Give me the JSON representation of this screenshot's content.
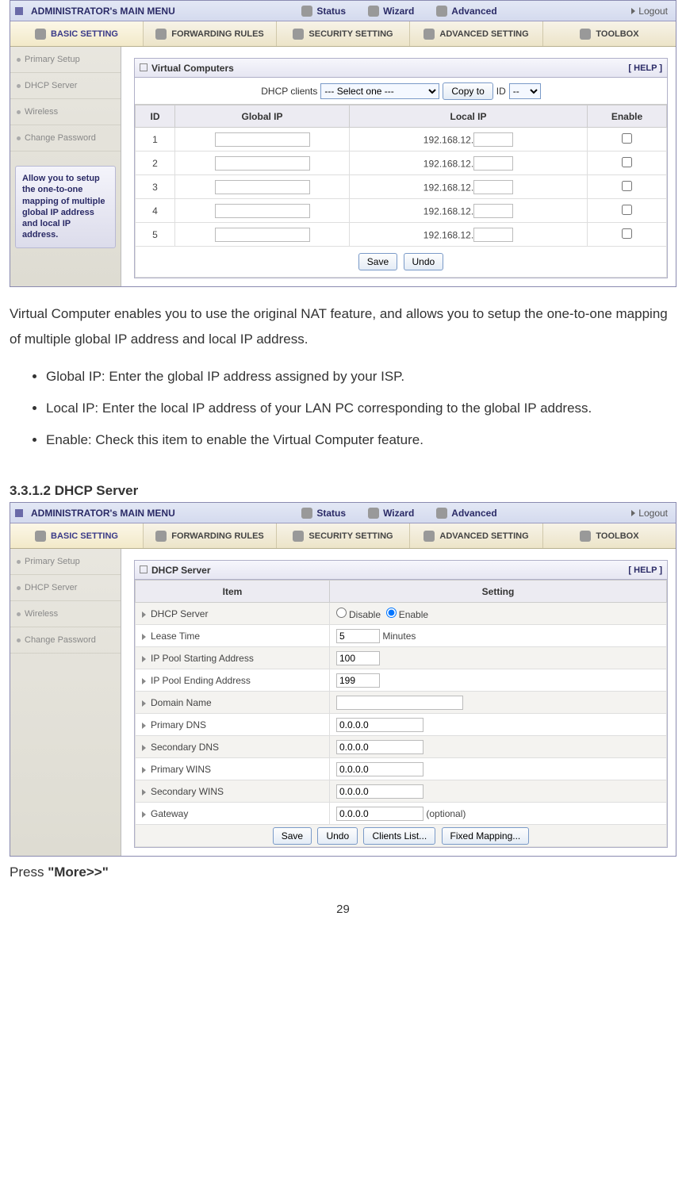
{
  "topbar": {
    "admin": "ADMINISTRATOR's MAIN MENU",
    "status": "Status",
    "wizard": "Wizard",
    "advanced": "Advanced",
    "logout": "Logout"
  },
  "tabs": {
    "basic": "BASIC SETTING",
    "forwarding": "FORWARDING RULES",
    "security": "SECURITY SETTING",
    "advanced": "ADVANCED SETTING",
    "toolbox": "TOOLBOX"
  },
  "sidebar": {
    "primary": "Primary Setup",
    "dhcp": "DHCP Server",
    "wireless": "Wireless",
    "password": "Change Password",
    "help": "Allow you to setup the one-to-one mapping of multiple global IP address and local IP address."
  },
  "vc": {
    "title": "Virtual Computers",
    "helpLabel": "[ HELP ]",
    "dhcpLabel": "DHCP clients",
    "selectOne": "--- Select one ---",
    "copyTo": "Copy to",
    "idLabel": "ID",
    "idSel": "--",
    "th": {
      "id": "ID",
      "global": "Global IP",
      "local": "Local IP",
      "enable": "Enable"
    },
    "rows": [
      {
        "id": "1",
        "prefix": "192.168.12."
      },
      {
        "id": "2",
        "prefix": "192.168.12."
      },
      {
        "id": "3",
        "prefix": "192.168.12."
      },
      {
        "id": "4",
        "prefix": "192.168.12."
      },
      {
        "id": "5",
        "prefix": "192.168.12."
      }
    ],
    "save": "Save",
    "undo": "Undo"
  },
  "desc": {
    "p1": "Virtual Computer enables you to use the original NAT feature, and allows you to setup the one-to-one mapping of multiple global IP address and local IP address.",
    "b1": "Global IP: Enter the global IP address assigned by your ISP.",
    "b2": "Local IP: Enter the local IP address of your LAN PC corresponding to the global IP address.",
    "b3": "Enable: Check this item to enable the Virtual Computer feature."
  },
  "secHeading": "3.3.1.2 DHCP Server",
  "dhcp": {
    "title": "DHCP Server",
    "helpLabel": "[ HELP ]",
    "th": {
      "item": "Item",
      "setting": "Setting"
    },
    "rows": {
      "server": {
        "k": "DHCP Server",
        "disable": "Disable",
        "enable": "Enable"
      },
      "lease": {
        "k": "Lease Time",
        "v": "5",
        "unit": "Minutes"
      },
      "poolStart": {
        "k": "IP Pool Starting Address",
        "v": "100"
      },
      "poolEnd": {
        "k": "IP Pool Ending Address",
        "v": "199"
      },
      "domain": {
        "k": "Domain Name",
        "v": ""
      },
      "pdns": {
        "k": "Primary DNS",
        "v": "0.0.0.0"
      },
      "sdns": {
        "k": "Secondary DNS",
        "v": "0.0.0.0"
      },
      "pwins": {
        "k": "Primary WINS",
        "v": "0.0.0.0"
      },
      "swins": {
        "k": "Secondary WINS",
        "v": "0.0.0.0"
      },
      "gateway": {
        "k": "Gateway",
        "v": "0.0.0.0",
        "note": "(optional)"
      }
    },
    "btns": {
      "save": "Save",
      "undo": "Undo",
      "clients": "Clients List...",
      "fixed": "Fixed Mapping..."
    }
  },
  "after": {
    "pre": "Press ",
    "bold": "\"More>>\""
  },
  "page": "29"
}
